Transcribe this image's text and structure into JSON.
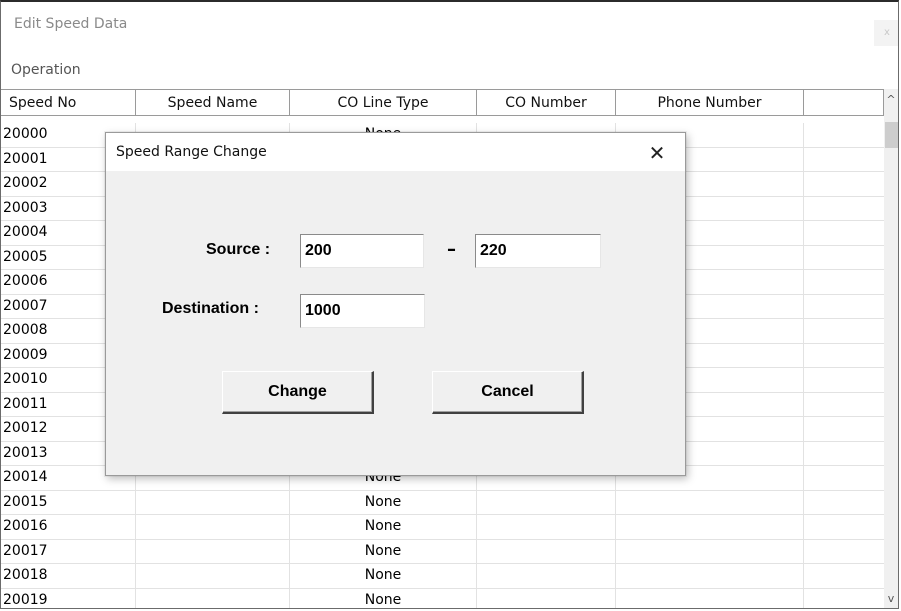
{
  "window": {
    "title": "Edit Speed Data",
    "close_glyph": "x"
  },
  "menu": {
    "items": [
      {
        "label": "Operation"
      }
    ]
  },
  "table": {
    "columns": [
      "Speed No",
      "Speed Name",
      "CO Line Type",
      "CO Number",
      "Phone Number",
      ""
    ],
    "rows": [
      {
        "speed_no": "20000",
        "co_line_type": "None"
      },
      {
        "speed_no": "20001",
        "co_line_type": ""
      },
      {
        "speed_no": "20002",
        "co_line_type": ""
      },
      {
        "speed_no": "20003",
        "co_line_type": ""
      },
      {
        "speed_no": "20004",
        "co_line_type": ""
      },
      {
        "speed_no": "20005",
        "co_line_type": ""
      },
      {
        "speed_no": "20006",
        "co_line_type": ""
      },
      {
        "speed_no": "20007",
        "co_line_type": ""
      },
      {
        "speed_no": "20008",
        "co_line_type": ""
      },
      {
        "speed_no": "20009",
        "co_line_type": ""
      },
      {
        "speed_no": "20010",
        "co_line_type": ""
      },
      {
        "speed_no": "20011",
        "co_line_type": ""
      },
      {
        "speed_no": "20012",
        "co_line_type": ""
      },
      {
        "speed_no": "20013",
        "co_line_type": ""
      },
      {
        "speed_no": "20014",
        "co_line_type": "None"
      },
      {
        "speed_no": "20015",
        "co_line_type": "None"
      },
      {
        "speed_no": "20016",
        "co_line_type": "None"
      },
      {
        "speed_no": "20017",
        "co_line_type": "None"
      },
      {
        "speed_no": "20018",
        "co_line_type": "None"
      },
      {
        "speed_no": "20019",
        "co_line_type": "None"
      }
    ]
  },
  "dialog": {
    "title": "Speed Range Change",
    "close_glyph": "✕",
    "source_label": "Source :",
    "source_from": "200",
    "range_separator": "–",
    "source_to": "220",
    "destination_label": "Destination :",
    "destination": "1000",
    "change_label": "Change",
    "cancel_label": "Cancel"
  },
  "scrollbar": {
    "up_glyph": "^",
    "down_glyph": "v"
  }
}
